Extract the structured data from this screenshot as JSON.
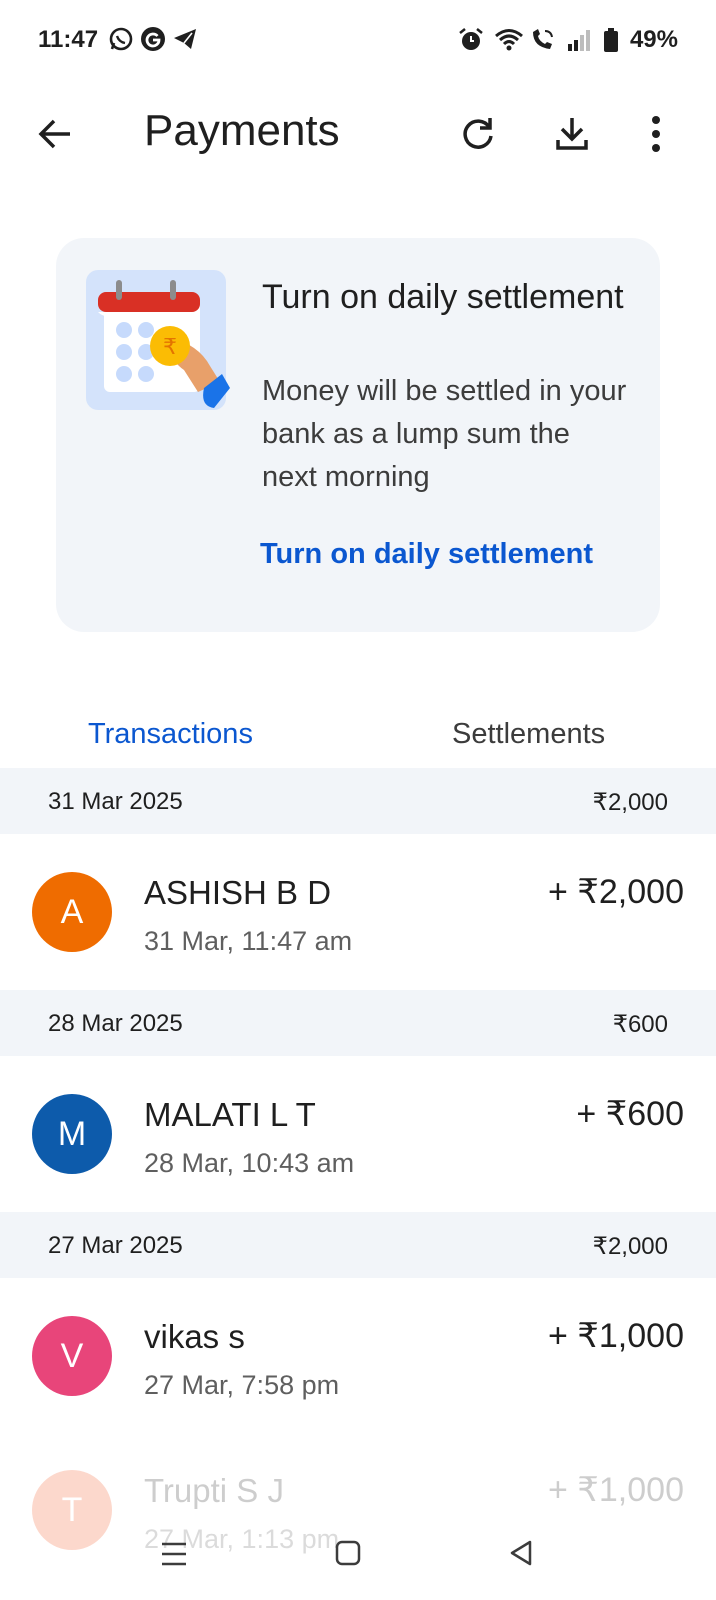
{
  "status_bar": {
    "time": "11:47",
    "battery": "49%",
    "left_icons": [
      "whatsapp-icon",
      "google-icon",
      "telegram-icon"
    ],
    "right_icons": [
      "alarm-icon",
      "wifi-icon",
      "wifi-call-icon",
      "signal-icon",
      "battery-icon"
    ]
  },
  "app_bar": {
    "title": "Payments",
    "actions": [
      "back-arrow-icon",
      "refresh-icon",
      "download-icon",
      "more-vert-icon"
    ]
  },
  "promo": {
    "title": "Turn on daily settlement",
    "description": "Money will be settled in your bank as a lump sum the next morning",
    "cta": "Turn on daily settlement",
    "illustration": "calendar-coin-icon"
  },
  "tabs": [
    {
      "label": "Transactions",
      "selected": true
    },
    {
      "label": "Settlements",
      "selected": false
    }
  ],
  "groups": [
    {
      "date": "31 Mar 2025",
      "total": "₹2,000",
      "transactions": [
        {
          "initial": "A",
          "name": "ASHISH B D",
          "time": "31 Mar, 11:47 am",
          "amount": "+ ₹2,000",
          "color": "#ef6c00"
        }
      ]
    },
    {
      "date": "28 Mar 2025",
      "total": "₹600",
      "transactions": [
        {
          "initial": "M",
          "name": "MALATI L T",
          "time": "28 Mar, 10:43 am",
          "amount": "+ ₹600",
          "color": "#0d5bab"
        }
      ]
    },
    {
      "date": "27 Mar 2025",
      "total": "₹2,000",
      "transactions": [
        {
          "initial": "V",
          "name": "vikas s",
          "time": "27 Mar, 7:58 pm",
          "amount": "+ ₹1,000",
          "color": "#e8457a"
        },
        {
          "initial": "T",
          "name": "Trupti S J",
          "time": "27 Mar, 1:13 pm",
          "amount": "+ ₹1,000",
          "color": "#f4511e"
        }
      ]
    }
  ],
  "nav_bar": {
    "buttons": [
      "recents-icon",
      "home-icon",
      "back-icon"
    ]
  },
  "colors": {
    "accent": "#0b57d0",
    "card_bg": "#f2f5f9",
    "text": "#1f1f1f"
  }
}
